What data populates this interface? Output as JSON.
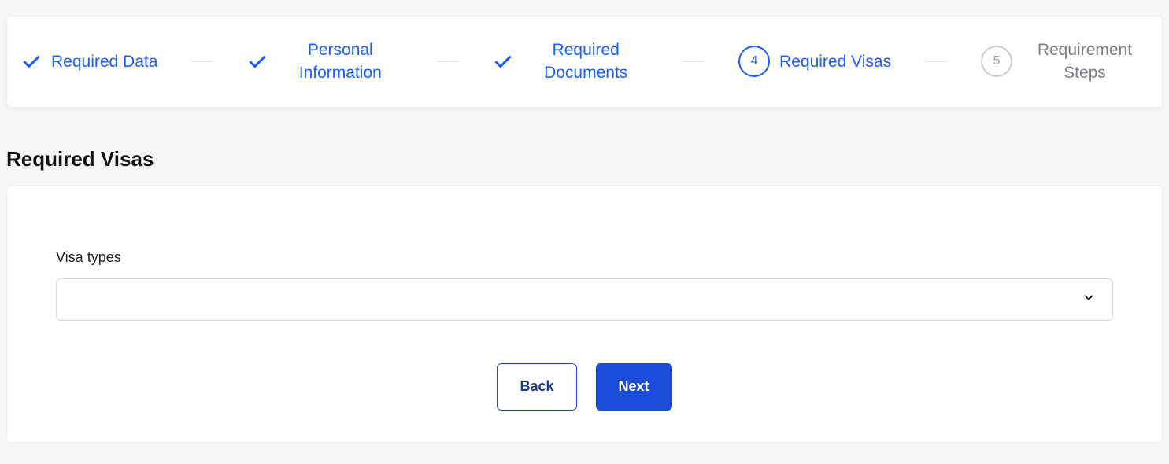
{
  "stepper": {
    "steps": [
      {
        "label": "Required Data",
        "state": "done"
      },
      {
        "label": "Personal Information",
        "state": "done"
      },
      {
        "label": "Required Documents",
        "state": "done"
      },
      {
        "label": "Required Visas",
        "state": "active",
        "number": "4"
      },
      {
        "label": "Requirement Steps",
        "state": "inactive",
        "number": "5"
      }
    ]
  },
  "section": {
    "title": "Required Visas"
  },
  "form": {
    "visa_types_label": "Visa types",
    "visa_types_value": ""
  },
  "actions": {
    "back": "Back",
    "next": "Next"
  }
}
